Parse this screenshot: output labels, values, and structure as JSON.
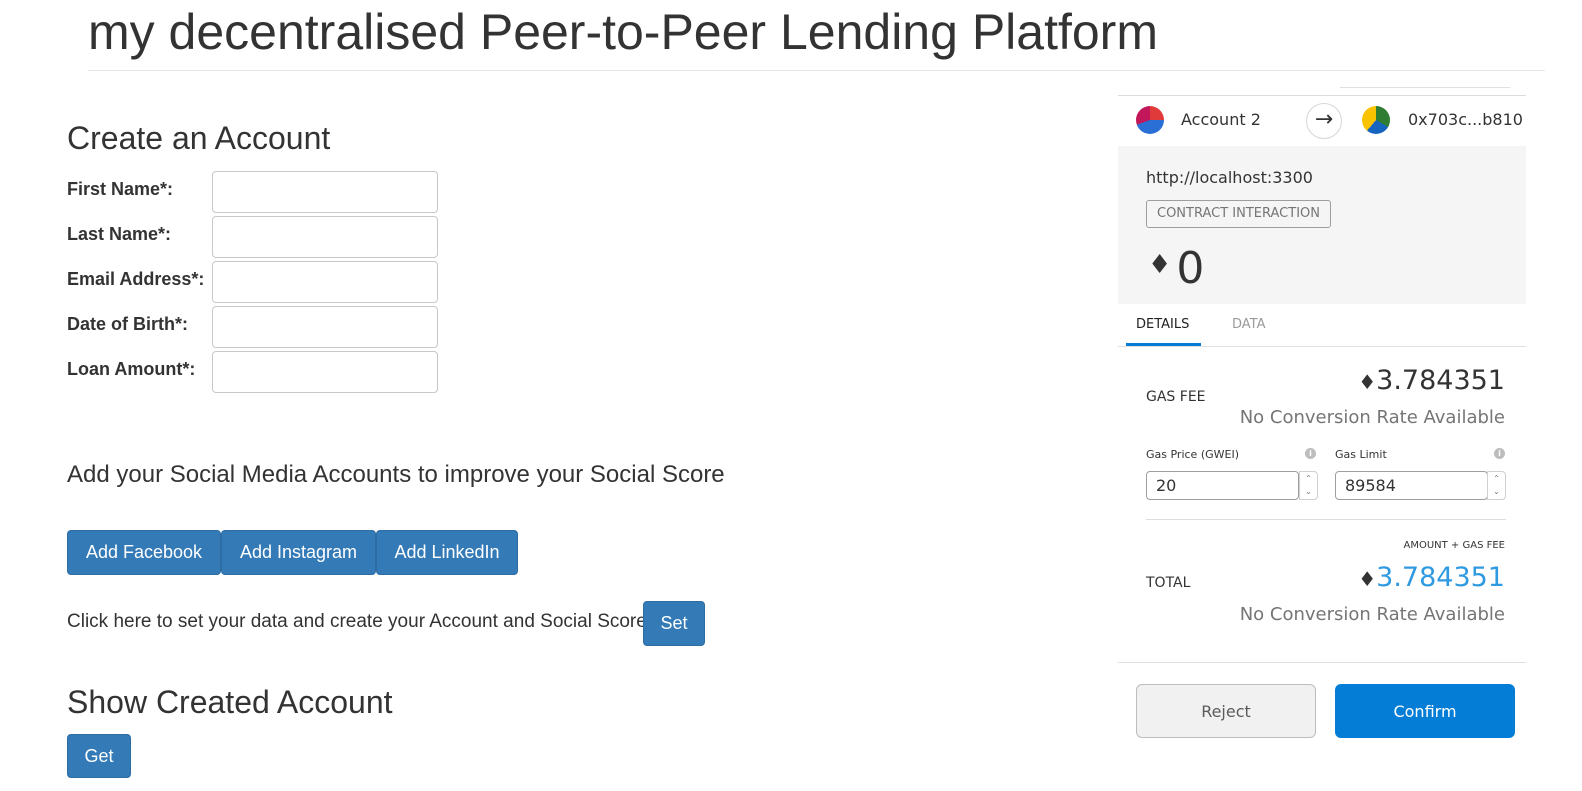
{
  "page": {
    "title": "my decentralised Peer-to-Peer Lending Platform"
  },
  "create_account": {
    "heading": "Create an Account",
    "fields": [
      {
        "label": "First Name*:",
        "value": ""
      },
      {
        "label": "Last Name*:",
        "value": ""
      },
      {
        "label": "Email Address*:",
        "value": ""
      },
      {
        "label": "Date of Birth*:",
        "value": ""
      },
      {
        "label": "Loan Amount*:",
        "value": ""
      }
    ]
  },
  "social": {
    "text": "Add your Social Media Accounts to improve your Social Score",
    "buttons": [
      "Add Facebook",
      "Add Instagram",
      "Add LinkedIn"
    ]
  },
  "set_data": {
    "text": "Click here to set your data and create your Account and Social Score:",
    "button": "Set"
  },
  "show_account": {
    "heading": "Show Created Account",
    "button": "Get"
  },
  "metamask": {
    "from_account": "Account 2",
    "to_address": "0x703c...b810",
    "origin": "http://localhost:3300",
    "badge": "CONTRACT INTERACTION",
    "amount": "0",
    "tabs": [
      "DETAILS",
      "DATA"
    ],
    "active_tab": "DETAILS",
    "gas_fee_label": "GAS FEE",
    "gas_fee": "3.784351",
    "no_conversion": "No Conversion Rate Available",
    "gas_price_label": "Gas Price (GWEI)",
    "gas_price": "20",
    "gas_limit_label": "Gas Limit",
    "gas_limit": "89584",
    "amount_gas_label": "AMOUNT + GAS FEE",
    "total_label": "TOTAL",
    "total": "3.784351",
    "reject_label": "Reject",
    "confirm_label": "Confirm"
  },
  "colors": {
    "primary_button": "#337ab7",
    "metamask_blue": "#037dd6",
    "total_blue": "#2f9ae0"
  },
  "icons": {
    "eth": "ethereum-icon",
    "arrow": "arrow-right-icon",
    "info": "info-icon"
  }
}
